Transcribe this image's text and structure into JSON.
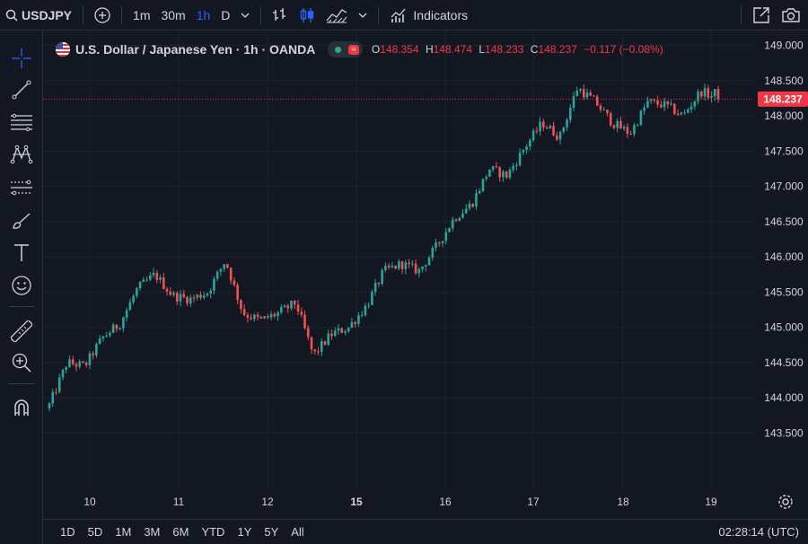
{
  "toolbar": {
    "symbol": "USDJPY",
    "intervals": [
      "1m",
      "30m",
      "1h",
      "D"
    ],
    "active_interval": "1h",
    "indicators_label": "Indicators"
  },
  "legend": {
    "title": "U.S. Dollar / Japanese Yen · 1h · OANDA",
    "o_label": "O",
    "o_value": "148.354",
    "h_label": "H",
    "h_value": "148.474",
    "l_label": "L",
    "l_value": "148.233",
    "c_label": "C",
    "c_value": "148.237",
    "change": "−0.117 (−0.08%)",
    "wave_glyph": "≈"
  },
  "bottom": {
    "ranges": [
      "1D",
      "5D",
      "1M",
      "3M",
      "6M",
      "YTD",
      "1Y",
      "5Y",
      "All"
    ],
    "clock": "02:28:14 (UTC)"
  },
  "colors": {
    "background": "#131722",
    "up": "#26a69a",
    "down": "#ef5350",
    "grid": "#1e222d",
    "axis_text": "#d1d4dc",
    "price_tag": "#f23645"
  },
  "chart_data": {
    "type": "candlestick",
    "symbol": "USDJPY",
    "timeframe": "1h",
    "y_axis": {
      "ticks": [
        "149.000",
        "148.500",
        "148.000",
        "147.500",
        "147.000",
        "146.500",
        "146.000",
        "145.500",
        "145.000",
        "144.500",
        "144.000",
        "143.500"
      ],
      "range": [
        143.4,
        149.1
      ],
      "side": "right"
    },
    "x_axis": {
      "ticks": [
        "10",
        "11",
        "12",
        "15",
        "16",
        "17",
        "18",
        "19"
      ],
      "bold_ticks": [
        "15"
      ]
    },
    "last_price": "148.237",
    "grid": true,
    "close_path": [
      [
        0,
        143.9
      ],
      [
        1,
        144.5
      ],
      [
        2,
        144.45
      ],
      [
        3,
        144.85
      ],
      [
        4,
        145.05
      ],
      [
        5,
        145.55
      ],
      [
        6,
        145.75
      ],
      [
        7,
        145.45
      ],
      [
        8,
        145.4
      ],
      [
        9,
        145.5
      ],
      [
        10,
        145.95
      ],
      [
        11,
        145.2
      ],
      [
        12,
        145.1
      ],
      [
        13,
        145.2
      ],
      [
        14,
        145.35
      ],
      [
        15,
        144.6
      ],
      [
        16,
        144.9
      ],
      [
        17,
        145.0
      ],
      [
        18,
        145.3
      ],
      [
        19,
        145.8
      ],
      [
        20,
        145.9
      ],
      [
        21,
        145.8
      ],
      [
        22,
        146.15
      ],
      [
        23,
        146.55
      ],
      [
        24,
        146.75
      ],
      [
        25,
        147.25
      ],
      [
        26,
        147.15
      ],
      [
        27,
        147.55
      ],
      [
        28,
        147.9
      ],
      [
        29,
        147.7
      ],
      [
        30,
        148.4
      ],
      [
        31,
        148.2
      ],
      [
        32,
        147.9
      ],
      [
        33,
        147.75
      ],
      [
        34,
        148.2
      ],
      [
        35,
        148.15
      ],
      [
        36,
        148.0
      ],
      [
        37,
        148.35
      ],
      [
        38,
        148.24
      ]
    ]
  }
}
